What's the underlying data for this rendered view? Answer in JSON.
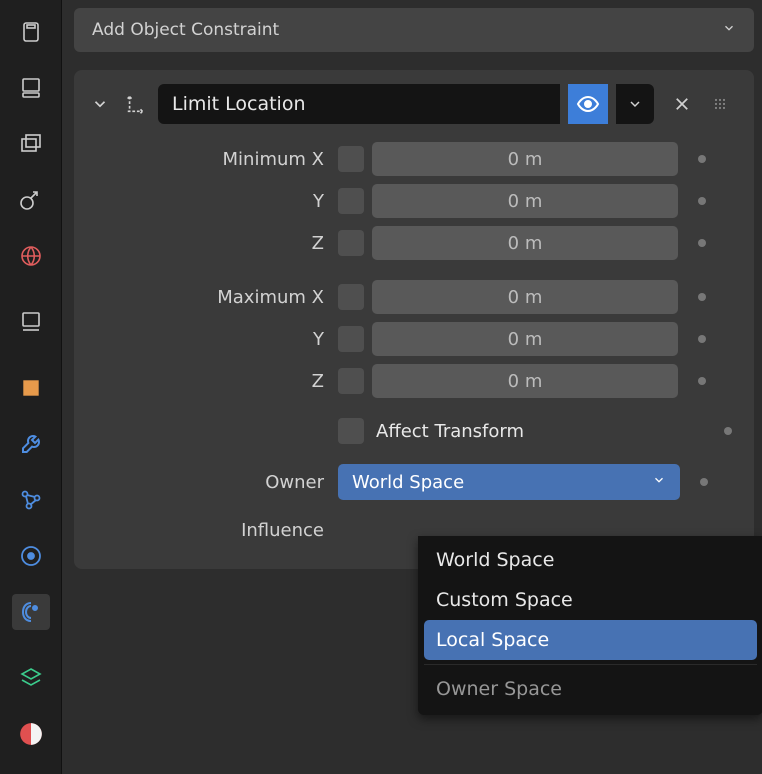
{
  "header": {
    "add_constraint_label": "Add Object Constraint"
  },
  "constraint": {
    "name": "Limit Location",
    "min": {
      "group_label": "Minimum X",
      "x": "0 m",
      "y_label": "Y",
      "y": "0 m",
      "z_label": "Z",
      "z": "0 m"
    },
    "max": {
      "group_label": "Maximum X",
      "x": "0 m",
      "y_label": "Y",
      "y": "0 m",
      "z_label": "Z",
      "z": "0 m"
    },
    "affect_label": "Affect Transform",
    "owner_label": "Owner",
    "owner_value": "World Space",
    "influence_label": "Influence"
  },
  "dropdown": {
    "options": [
      "World Space",
      "Custom Space",
      "Local Space"
    ],
    "highlighted": "Local Space",
    "section_header": "Owner Space"
  },
  "tabs": [
    "render-icon",
    "output-icon",
    "view-layers-icon",
    "scene-icon",
    "world-icon",
    "object-icon",
    "modifiers-icon",
    "particles-icon",
    "physics-icon",
    "constraints-icon",
    "data-icon",
    "material-icon"
  ],
  "icons": {
    "collapse": "chevron-down-icon",
    "panel_mode": "axis-icon",
    "eye": "eye-icon",
    "expand": "chevron-down-icon",
    "close": "close-icon",
    "grip": "grip-icon",
    "select_chevron": "chevron-down-icon"
  },
  "colors": {
    "accent": "#4772b3"
  }
}
